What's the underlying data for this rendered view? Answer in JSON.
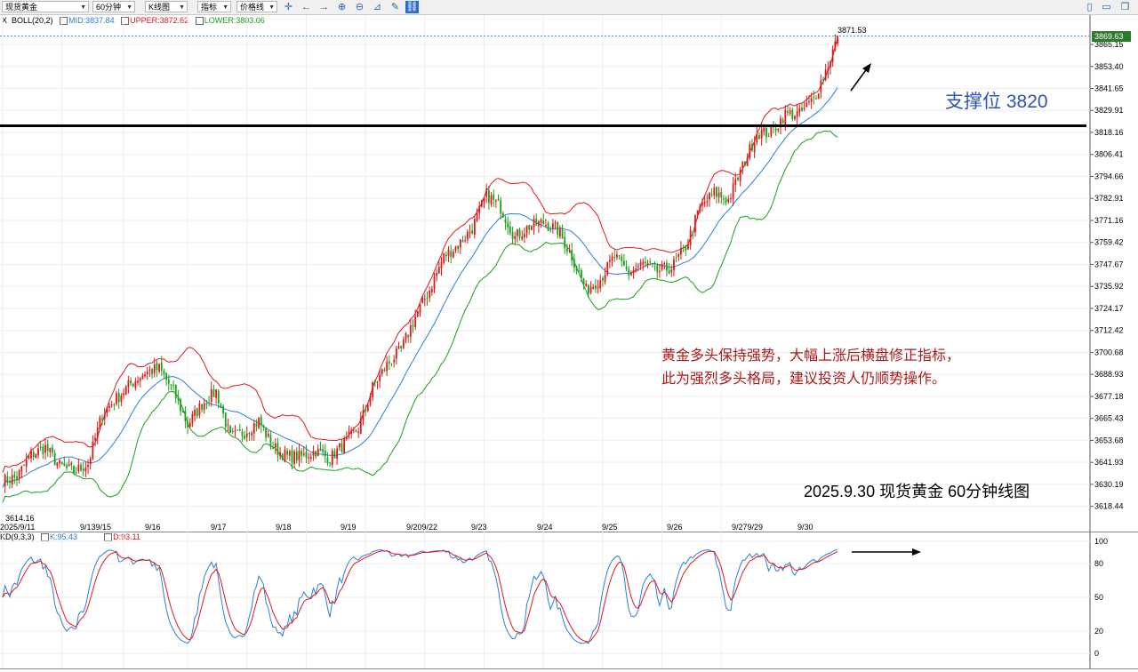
{
  "toolbar": {
    "symbol": "现货黄金",
    "period": "60分钟",
    "chart_kind": "K线图",
    "indicator": "指标",
    "price_line": "价格线",
    "icons": [
      "crosshair-icon",
      "arrow-left-icon",
      "arrow-right-icon",
      "zoom-in-icon",
      "zoom-out-icon",
      "draw-tools-icon",
      "pencil-icon",
      "link-icon"
    ],
    "right_icons": [
      "panel-icon",
      "page-icon",
      "restore-icon"
    ]
  },
  "main_legend": {
    "prefix": "X",
    "boll": "BOLL(20,2)",
    "mid": "MID:3837.84",
    "upper": "UPPER:3872.62",
    "lower": "LOWER:3803.06"
  },
  "kdj_legend": {
    "name": "KD(9,3,3)",
    "k": "K:95.43",
    "d": "D:93.11"
  },
  "annotations": {
    "support": "支撑位 3820",
    "comment_line1": "黄金多头保持强势，大幅上涨后横盘修正指标，",
    "comment_line2": "此为强烈多头格局，建议投资人仍顺势操作。",
    "caption": "2025.9.30 现货黄金 60分钟线图",
    "high_label": "3871.53",
    "low_label": "3614.16"
  },
  "colors": {
    "up": "#e01818",
    "down": "#19a019",
    "mid": "#2a7fd4",
    "upper": "#e01818",
    "lower": "#19a019",
    "support_line": "#000000",
    "annotation_blue": "#2e52b8",
    "annotation_red": "#b01818"
  },
  "chart_data": [
    {
      "type": "candlestick",
      "title": "",
      "y_ticks": [
        3865.15,
        3853.4,
        3841.65,
        3829.91,
        3818.16,
        3806.41,
        3794.66,
        3782.91,
        3771.16,
        3759.42,
        3747.67,
        3735.92,
        3724.17,
        3712.42,
        3700.68,
        3688.93,
        3677.18,
        3665.43,
        3653.68,
        3641.93,
        3630.19,
        3618.44
      ],
      "ylim": [
        3611,
        3878
      ],
      "last_price": "3869.63",
      "x_labels": [
        "2025/9/11",
        "9/139/15",
        "9/16",
        "9/17",
        "9/18",
        "9/19",
        "9/209/22",
        "9/23",
        "9/24",
        "9/25",
        "9/26",
        "9/279/29",
        "9/30"
      ],
      "support_level": 3820,
      "close_keypoints": [
        [
          0,
          3632
        ],
        [
          6,
          3634
        ],
        [
          12,
          3646
        ],
        [
          18,
          3650
        ],
        [
          24,
          3640
        ],
        [
          30,
          3637
        ],
        [
          36,
          3641
        ],
        [
          42,
          3668
        ],
        [
          48,
          3676
        ],
        [
          54,
          3684
        ],
        [
          60,
          3690
        ],
        [
          66,
          3692
        ],
        [
          72,
          3680
        ],
        [
          78,
          3662
        ],
        [
          84,
          3673
        ],
        [
          90,
          3680
        ],
        [
          96,
          3655
        ],
        [
          102,
          3658
        ],
        [
          108,
          3664
        ],
        [
          114,
          3650
        ],
        [
          120,
          3645
        ],
        [
          126,
          3645
        ],
        [
          132,
          3648
        ],
        [
          138,
          3644
        ],
        [
          144,
          3652
        ],
        [
          150,
          3660
        ],
        [
          156,
          3682
        ],
        [
          162,
          3694
        ],
        [
          168,
          3702
        ],
        [
          174,
          3720
        ],
        [
          180,
          3734
        ],
        [
          186,
          3752
        ],
        [
          192,
          3758
        ],
        [
          198,
          3767
        ],
        [
          204,
          3785
        ],
        [
          210,
          3778
        ],
        [
          216,
          3762
        ],
        [
          222,
          3768
        ],
        [
          228,
          3770
        ],
        [
          234,
          3766
        ],
        [
          240,
          3752
        ],
        [
          246,
          3734
        ],
        [
          252,
          3740
        ],
        [
          258,
          3752
        ],
        [
          264,
          3743
        ],
        [
          270,
          3748
        ],
        [
          276,
          3744
        ],
        [
          282,
          3746
        ],
        [
          288,
          3757
        ],
        [
          294,
          3778
        ],
        [
          300,
          3786
        ],
        [
          306,
          3782
        ],
        [
          312,
          3800
        ],
        [
          318,
          3818
        ],
        [
          324,
          3818
        ],
        [
          330,
          3828
        ],
        [
          336,
          3828
        ],
        [
          342,
          3836
        ],
        [
          348,
          3854
        ],
        [
          352,
          3869.63
        ]
      ],
      "series": [
        {
          "name": "MID",
          "values": "20-period moving average of close"
        },
        {
          "name": "UPPER",
          "values": "MID + 2 standard deviations"
        },
        {
          "name": "LOWER",
          "values": "MID - 2 standard deviations"
        }
      ]
    },
    {
      "type": "line",
      "title": "",
      "y_ticks": [
        100,
        80,
        50,
        20,
        0
      ],
      "ylim": [
        0,
        100
      ],
      "series": [
        {
          "name": "K",
          "last": 95.43
        },
        {
          "name": "D",
          "last": 93.11
        }
      ]
    }
  ]
}
